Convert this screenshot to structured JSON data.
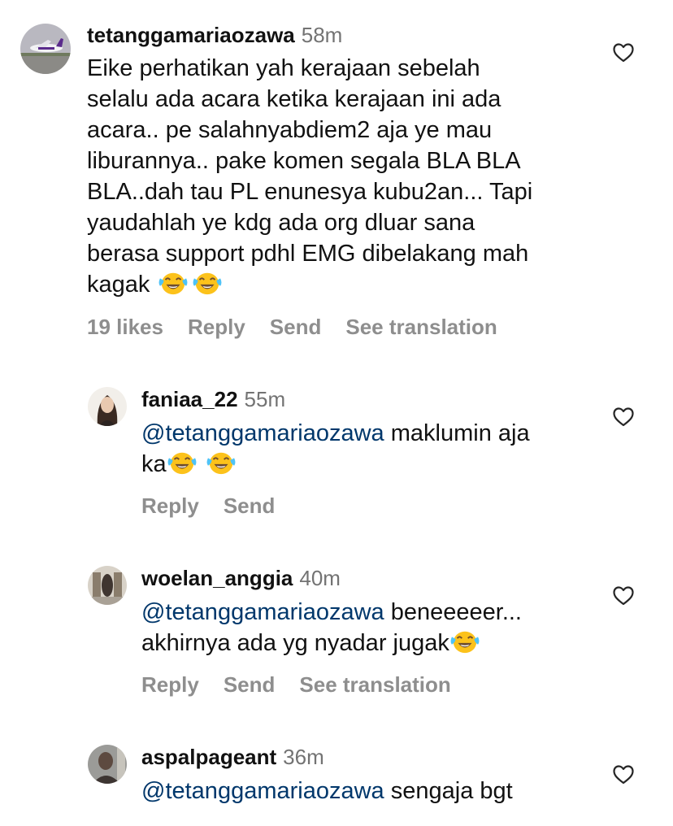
{
  "comments": [
    {
      "username": "tetanggamariaozawa",
      "time": "58m",
      "lines": [
        "Eike perhatikan yah kerajaan sebelah",
        "selalu ada acara ketika kerajaan ini ada",
        "acara.. pe salahnyabdiem2 aja ye mau",
        "liburannya.. pake komen segala BLA BLA",
        "BLA..dah tau PL enunesya kubu2an... Tapi",
        "yaudahlah ye kdg ada org dluar sana",
        "berasa support pdhl EMG dibelakang mah",
        "kagak"
      ],
      "emoji_name": "face-with-tears-of-joy",
      "likes": "19 likes",
      "reply": "Reply",
      "send": "Send",
      "translation": "See translation",
      "avatar_icon": "airplane-avatar"
    },
    {
      "username": "faniaa_22",
      "time": "55m",
      "mention": "@tetanggamariaozawa",
      "line1": "maklumin aja",
      "line2": "ka",
      "reply": "Reply",
      "send": "Send",
      "avatar_icon": "portrait-avatar"
    },
    {
      "username": "woelan_anggia",
      "time": "40m",
      "mention": "@tetanggamariaozawa",
      "line1": "beneeeeer...",
      "line2": "akhirnya ada yg nyadar jugak",
      "reply": "Reply",
      "send": "Send",
      "translation": "See translation",
      "avatar_icon": "room-avatar"
    },
    {
      "username": "aspalpageant",
      "time": "36m",
      "mention": "@tetanggamariaozawa",
      "line1": "sengaja bgt",
      "avatar_icon": "person-avatar"
    }
  ],
  "icons": {
    "like": "heart-outline-icon",
    "emoji": "face-with-tears-of-joy"
  },
  "colors": {
    "mention": "#00376b",
    "meta": "#737373",
    "action": "#8e8e8e",
    "emoji_face": "#fcc21b"
  }
}
